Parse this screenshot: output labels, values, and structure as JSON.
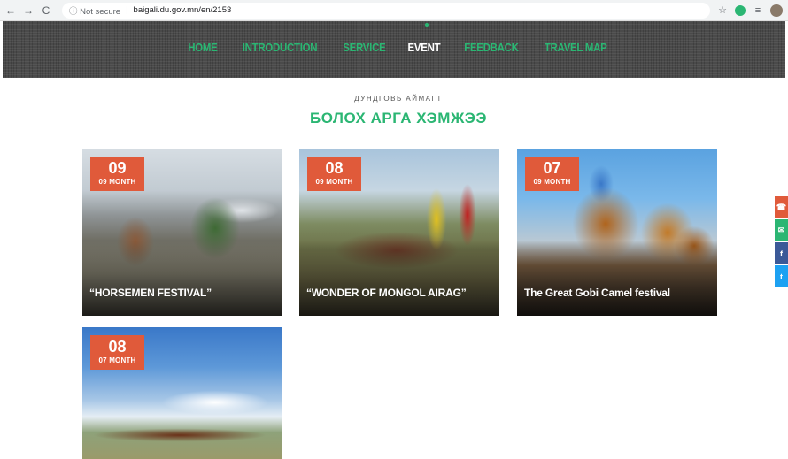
{
  "browser": {
    "back_icon": "←",
    "forward_icon": "→",
    "reload_icon": "C",
    "security_label": "ⓘ Not secure",
    "url": "baigali.du.gov.mn/en/2153",
    "star_icon": "☆",
    "menu_icon": "≡"
  },
  "nav": {
    "items": [
      "HOME",
      "INTRODUCTION",
      "SERVICE",
      "EVENT",
      "FEEDBACK",
      "TRAVEL MAP"
    ],
    "active": "EVENT"
  },
  "page": {
    "subtitle": "ДУНДГОВЬ АЙМАГТ",
    "title": "БОЛОХ АРГА ХЭМЖЭЭ"
  },
  "events": [
    {
      "day": "09",
      "month": "09 MONTH",
      "title": "“HORSEMEN FESTIVAL”"
    },
    {
      "day": "08",
      "month": "09 MONTH",
      "title": "“WONDER OF MONGOL AIRAG”"
    },
    {
      "day": "07",
      "month": "09 MONTH",
      "title": "The Great Gobi Camel festival"
    },
    {
      "day": "08",
      "month": "07 MONTH",
      "title": ""
    }
  ],
  "social": {
    "phone_icon": "☎",
    "chat_icon": "✉",
    "facebook_icon": "f",
    "twitter_icon": "t"
  },
  "colors": {
    "accent": "#2bb673",
    "badge": "#e05a3a",
    "header_bg": "#4a4a4a"
  }
}
